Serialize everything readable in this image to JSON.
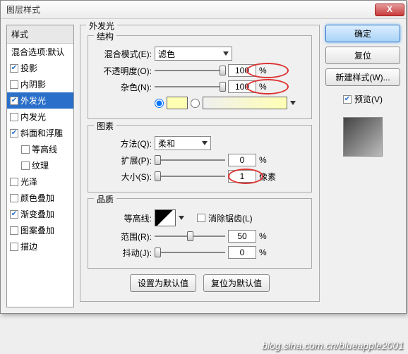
{
  "title": "图层样式",
  "sidebar": {
    "header": "样式",
    "blend_options": "混合选项:默认",
    "items": [
      {
        "label": "投影",
        "checked": true
      },
      {
        "label": "内阴影",
        "checked": false
      },
      {
        "label": "外发光",
        "checked": true,
        "selected": true
      },
      {
        "label": "内发光",
        "checked": false
      },
      {
        "label": "斜面和浮雕",
        "checked": true
      },
      {
        "label": "等高线",
        "checked": false,
        "indent": true
      },
      {
        "label": "纹理",
        "checked": false,
        "indent": true
      },
      {
        "label": "光泽",
        "checked": false
      },
      {
        "label": "颜色叠加",
        "checked": false
      },
      {
        "label": "渐变叠加",
        "checked": true
      },
      {
        "label": "图案叠加",
        "checked": false
      },
      {
        "label": "描边",
        "checked": false
      }
    ]
  },
  "panel_title": "外发光",
  "structure": {
    "legend": "结构",
    "blend_mode_label": "混合模式(E):",
    "blend_mode_value": "滤色",
    "opacity_label": "不透明度(O):",
    "opacity_value": "100",
    "noise_label": "杂色(N):",
    "noise_value": "100",
    "pct": "%",
    "color": "#ffffb4"
  },
  "elements": {
    "legend": "图素",
    "method_label": "方法(Q):",
    "method_value": "柔和",
    "spread_label": "扩展(P):",
    "spread_value": "0",
    "size_label": "大小(S):",
    "size_value": "1",
    "px": "像素",
    "pct": "%"
  },
  "quality": {
    "legend": "品质",
    "contour_label": "等高线:",
    "antialias_label": "消除锯齿(L)",
    "range_label": "范围(R):",
    "range_value": "50",
    "jitter_label": "抖动(J):",
    "jitter_value": "0",
    "pct": "%"
  },
  "footer": {
    "default_btn": "设置为默认值",
    "reset_btn": "复位为默认值"
  },
  "right": {
    "ok": "确定",
    "cancel": "复位",
    "new_style": "新建样式(W)...",
    "preview": "预览(V)"
  },
  "watermark": "blog.sina.com.cn/blueapple2001"
}
